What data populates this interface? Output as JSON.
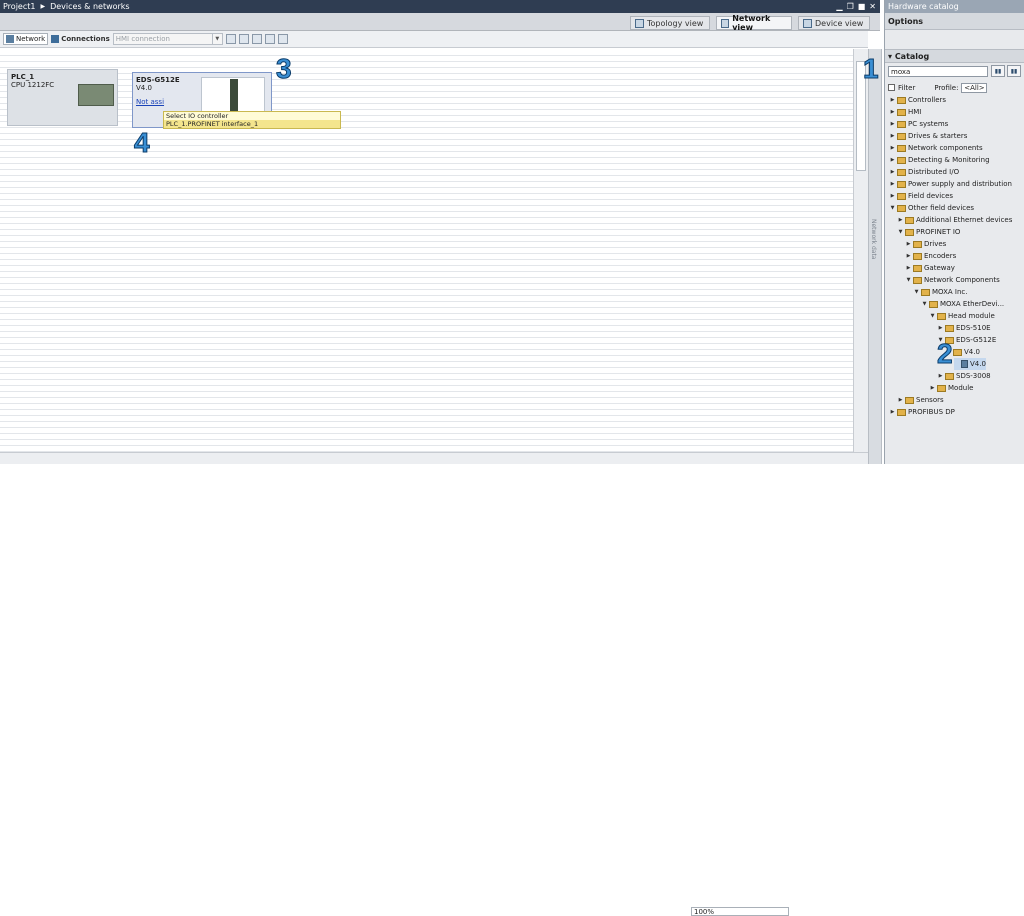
{
  "titlebar": {
    "project": "Project1",
    "section": "Devices & networks"
  },
  "sidebar_title": "Hardware catalog",
  "view_tabs": [
    {
      "label": "Topology view"
    },
    {
      "label": "Network view"
    },
    {
      "label": "Device view"
    }
  ],
  "toolbar": {
    "network": "Network",
    "connections": "Connections",
    "hmi": "HMI connection"
  },
  "devices": [
    {
      "name": "PLC_1",
      "sub": "CPU 1212FC"
    },
    {
      "name": "EDS-G512E",
      "sub": "V4.0",
      "status": "Not assi"
    }
  ],
  "ctx_menu": [
    "Select IO controller",
    "PLC_1.PROFINET interface_1"
  ],
  "zoom": "100%",
  "network_data_label": "Network data",
  "options_label": "Options",
  "catalog_label": "Catalog",
  "search_value": "moxa",
  "filter": {
    "label": "Filter",
    "profile_label": "Profile:",
    "profile_value": "<All>"
  },
  "tree": [
    {
      "label": "Controllers",
      "lvl": 0,
      "exp": false
    },
    {
      "label": "HMI",
      "lvl": 0,
      "exp": false
    },
    {
      "label": "PC systems",
      "lvl": 0,
      "exp": false
    },
    {
      "label": "Drives & starters",
      "lvl": 0,
      "exp": false
    },
    {
      "label": "Network components",
      "lvl": 0,
      "exp": false
    },
    {
      "label": "Detecting & Monitoring",
      "lvl": 0,
      "exp": false
    },
    {
      "label": "Distributed I/O",
      "lvl": 0,
      "exp": false
    },
    {
      "label": "Power supply and distribution",
      "lvl": 0,
      "exp": false
    },
    {
      "label": "Field devices",
      "lvl": 0,
      "exp": false
    },
    {
      "label": "Other field devices",
      "lvl": 0,
      "exp": true
    },
    {
      "label": "Additional Ethernet devices",
      "lvl": 1,
      "exp": false
    },
    {
      "label": "PROFINET IO",
      "lvl": 1,
      "exp": true
    },
    {
      "label": "Drives",
      "lvl": 2,
      "exp": false
    },
    {
      "label": "Encoders",
      "lvl": 2,
      "exp": false
    },
    {
      "label": "Gateway",
      "lvl": 2,
      "exp": false
    },
    {
      "label": "Network Components",
      "lvl": 2,
      "exp": true
    },
    {
      "label": "MOXA Inc.",
      "lvl": 3,
      "exp": true
    },
    {
      "label": "MOXA EtherDevi...",
      "lvl": 4,
      "exp": true
    },
    {
      "label": "Head module",
      "lvl": 5,
      "exp": true
    },
    {
      "label": "EDS-510E",
      "lvl": 6,
      "exp": false
    },
    {
      "label": "EDS-G512E",
      "lvl": 6,
      "exp": true
    },
    {
      "label": "V4.0",
      "lvl": 7,
      "exp": true
    },
    {
      "label": "V4.0",
      "lvl": 8,
      "leaf": true,
      "sel": true
    },
    {
      "label": "SDS-3008",
      "lvl": 6,
      "exp": false
    },
    {
      "label": "Module",
      "lvl": 5,
      "exp": false
    },
    {
      "label": "Sensors",
      "lvl": 1,
      "exp": false
    },
    {
      "label": "PROFIBUS DP",
      "lvl": 0,
      "exp": false
    }
  ],
  "badges": [
    "1",
    "2",
    "3",
    "4"
  ]
}
